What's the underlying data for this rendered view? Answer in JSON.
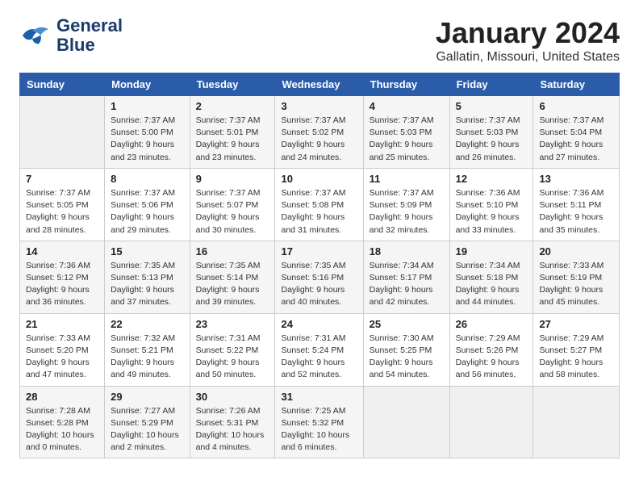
{
  "header": {
    "logo_line1": "General",
    "logo_line2": "Blue",
    "title": "January 2024",
    "subtitle": "Gallatin, Missouri, United States"
  },
  "days_of_week": [
    "Sunday",
    "Monday",
    "Tuesday",
    "Wednesday",
    "Thursday",
    "Friday",
    "Saturday"
  ],
  "weeks": [
    [
      {
        "num": "",
        "lines": []
      },
      {
        "num": "1",
        "lines": [
          "Sunrise: 7:37 AM",
          "Sunset: 5:00 PM",
          "Daylight: 9 hours",
          "and 23 minutes."
        ]
      },
      {
        "num": "2",
        "lines": [
          "Sunrise: 7:37 AM",
          "Sunset: 5:01 PM",
          "Daylight: 9 hours",
          "and 23 minutes."
        ]
      },
      {
        "num": "3",
        "lines": [
          "Sunrise: 7:37 AM",
          "Sunset: 5:02 PM",
          "Daylight: 9 hours",
          "and 24 minutes."
        ]
      },
      {
        "num": "4",
        "lines": [
          "Sunrise: 7:37 AM",
          "Sunset: 5:03 PM",
          "Daylight: 9 hours",
          "and 25 minutes."
        ]
      },
      {
        "num": "5",
        "lines": [
          "Sunrise: 7:37 AM",
          "Sunset: 5:03 PM",
          "Daylight: 9 hours",
          "and 26 minutes."
        ]
      },
      {
        "num": "6",
        "lines": [
          "Sunrise: 7:37 AM",
          "Sunset: 5:04 PM",
          "Daylight: 9 hours",
          "and 27 minutes."
        ]
      }
    ],
    [
      {
        "num": "7",
        "lines": [
          "Sunrise: 7:37 AM",
          "Sunset: 5:05 PM",
          "Daylight: 9 hours",
          "and 28 minutes."
        ]
      },
      {
        "num": "8",
        "lines": [
          "Sunrise: 7:37 AM",
          "Sunset: 5:06 PM",
          "Daylight: 9 hours",
          "and 29 minutes."
        ]
      },
      {
        "num": "9",
        "lines": [
          "Sunrise: 7:37 AM",
          "Sunset: 5:07 PM",
          "Daylight: 9 hours",
          "and 30 minutes."
        ]
      },
      {
        "num": "10",
        "lines": [
          "Sunrise: 7:37 AM",
          "Sunset: 5:08 PM",
          "Daylight: 9 hours",
          "and 31 minutes."
        ]
      },
      {
        "num": "11",
        "lines": [
          "Sunrise: 7:37 AM",
          "Sunset: 5:09 PM",
          "Daylight: 9 hours",
          "and 32 minutes."
        ]
      },
      {
        "num": "12",
        "lines": [
          "Sunrise: 7:36 AM",
          "Sunset: 5:10 PM",
          "Daylight: 9 hours",
          "and 33 minutes."
        ]
      },
      {
        "num": "13",
        "lines": [
          "Sunrise: 7:36 AM",
          "Sunset: 5:11 PM",
          "Daylight: 9 hours",
          "and 35 minutes."
        ]
      }
    ],
    [
      {
        "num": "14",
        "lines": [
          "Sunrise: 7:36 AM",
          "Sunset: 5:12 PM",
          "Daylight: 9 hours",
          "and 36 minutes."
        ]
      },
      {
        "num": "15",
        "lines": [
          "Sunrise: 7:35 AM",
          "Sunset: 5:13 PM",
          "Daylight: 9 hours",
          "and 37 minutes."
        ]
      },
      {
        "num": "16",
        "lines": [
          "Sunrise: 7:35 AM",
          "Sunset: 5:14 PM",
          "Daylight: 9 hours",
          "and 39 minutes."
        ]
      },
      {
        "num": "17",
        "lines": [
          "Sunrise: 7:35 AM",
          "Sunset: 5:16 PM",
          "Daylight: 9 hours",
          "and 40 minutes."
        ]
      },
      {
        "num": "18",
        "lines": [
          "Sunrise: 7:34 AM",
          "Sunset: 5:17 PM",
          "Daylight: 9 hours",
          "and 42 minutes."
        ]
      },
      {
        "num": "19",
        "lines": [
          "Sunrise: 7:34 AM",
          "Sunset: 5:18 PM",
          "Daylight: 9 hours",
          "and 44 minutes."
        ]
      },
      {
        "num": "20",
        "lines": [
          "Sunrise: 7:33 AM",
          "Sunset: 5:19 PM",
          "Daylight: 9 hours",
          "and 45 minutes."
        ]
      }
    ],
    [
      {
        "num": "21",
        "lines": [
          "Sunrise: 7:33 AM",
          "Sunset: 5:20 PM",
          "Daylight: 9 hours",
          "and 47 minutes."
        ]
      },
      {
        "num": "22",
        "lines": [
          "Sunrise: 7:32 AM",
          "Sunset: 5:21 PM",
          "Daylight: 9 hours",
          "and 49 minutes."
        ]
      },
      {
        "num": "23",
        "lines": [
          "Sunrise: 7:31 AM",
          "Sunset: 5:22 PM",
          "Daylight: 9 hours",
          "and 50 minutes."
        ]
      },
      {
        "num": "24",
        "lines": [
          "Sunrise: 7:31 AM",
          "Sunset: 5:24 PM",
          "Daylight: 9 hours",
          "and 52 minutes."
        ]
      },
      {
        "num": "25",
        "lines": [
          "Sunrise: 7:30 AM",
          "Sunset: 5:25 PM",
          "Daylight: 9 hours",
          "and 54 minutes."
        ]
      },
      {
        "num": "26",
        "lines": [
          "Sunrise: 7:29 AM",
          "Sunset: 5:26 PM",
          "Daylight: 9 hours",
          "and 56 minutes."
        ]
      },
      {
        "num": "27",
        "lines": [
          "Sunrise: 7:29 AM",
          "Sunset: 5:27 PM",
          "Daylight: 9 hours",
          "and 58 minutes."
        ]
      }
    ],
    [
      {
        "num": "28",
        "lines": [
          "Sunrise: 7:28 AM",
          "Sunset: 5:28 PM",
          "Daylight: 10 hours",
          "and 0 minutes."
        ]
      },
      {
        "num": "29",
        "lines": [
          "Sunrise: 7:27 AM",
          "Sunset: 5:29 PM",
          "Daylight: 10 hours",
          "and 2 minutes."
        ]
      },
      {
        "num": "30",
        "lines": [
          "Sunrise: 7:26 AM",
          "Sunset: 5:31 PM",
          "Daylight: 10 hours",
          "and 4 minutes."
        ]
      },
      {
        "num": "31",
        "lines": [
          "Sunrise: 7:25 AM",
          "Sunset: 5:32 PM",
          "Daylight: 10 hours",
          "and 6 minutes."
        ]
      },
      {
        "num": "",
        "lines": []
      },
      {
        "num": "",
        "lines": []
      },
      {
        "num": "",
        "lines": []
      }
    ]
  ]
}
